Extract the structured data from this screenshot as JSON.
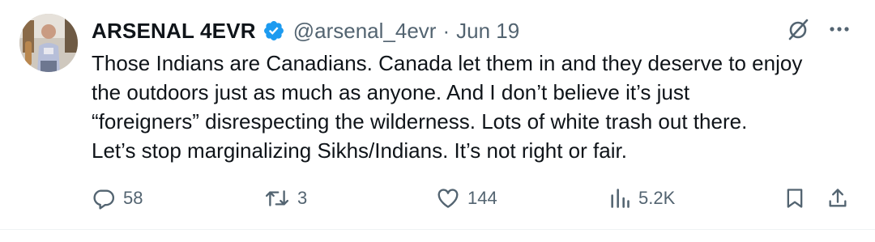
{
  "author": {
    "display_name": "ARSENAL 4EVR",
    "handle": "@arsenal_4evr",
    "separator": "·",
    "date": "Jun 19"
  },
  "tweet": {
    "lines": [
      "Those Indians are Canadians. Canada let them in and they deserve to enjoy",
      "the outdoors just as much as anyone. And I don’t believe it’s just",
      "“foreigners” disrespecting the wilderness. Lots of white trash out there.",
      "Let’s stop marginalizing Sikhs/Indians. It’s not right or fair."
    ]
  },
  "actions": {
    "replies": "58",
    "reposts": "3",
    "likes": "144",
    "views": "5.2K"
  },
  "icons": {
    "verified": "verified-badge-icon",
    "grok": "grok-icon",
    "more": "more-icon",
    "reply": "reply-icon",
    "repost": "repost-icon",
    "like": "heart-icon",
    "views": "views-icon",
    "bookmark": "bookmark-icon",
    "share": "share-icon"
  },
  "colors": {
    "text": "#0f1419",
    "secondary": "#536471",
    "verified": "#1d9bf0",
    "background": "#ffffff"
  }
}
